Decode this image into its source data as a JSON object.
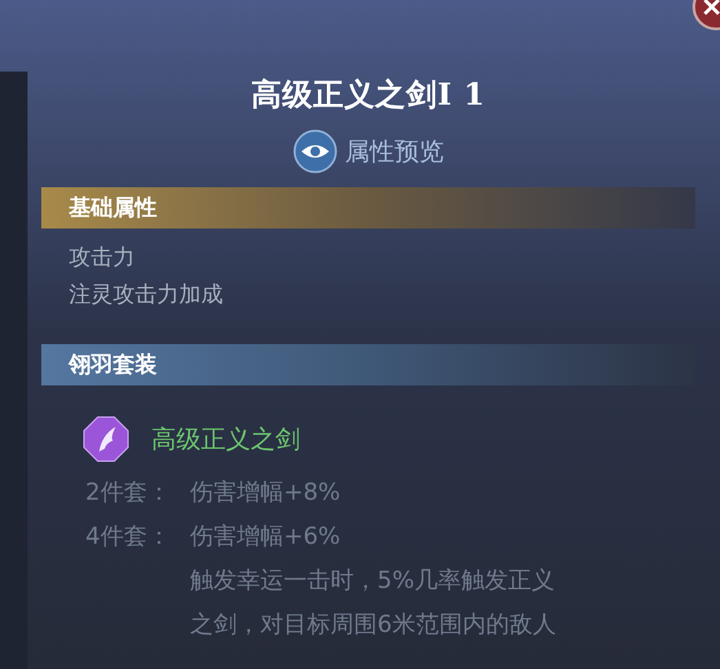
{
  "title": "高级正义之剑I 1",
  "preview_label": "属性预览",
  "sections": [
    {
      "kind": "base",
      "title": "基础属性",
      "lines": [
        "攻击力",
        "注灵攻击力加成"
      ]
    },
    {
      "kind": "set",
      "title": "翎羽套装",
      "set_name": "高级正义之剑",
      "bonuses": [
        {
          "label": "2件套：",
          "effect": "伤害增幅+8%"
        },
        {
          "label": "4件套：",
          "effect": "伤害增幅+6%",
          "description": [
            "触发幸运一击时，5%几率触发正义",
            "之剑，对目标周围6米范围内的敌人"
          ]
        }
      ]
    }
  ]
}
